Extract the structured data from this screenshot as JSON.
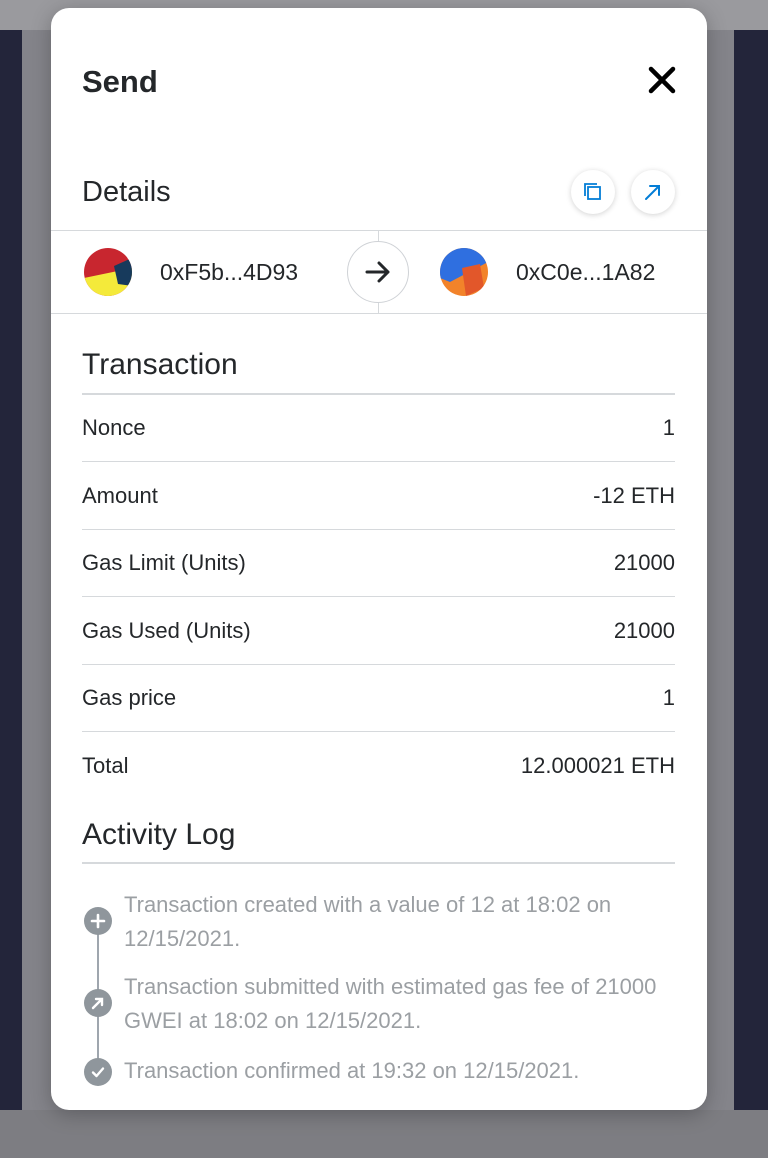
{
  "modal": {
    "title": "Send",
    "details_title": "Details",
    "from": {
      "address": "0xF5b...4D93"
    },
    "to": {
      "address": "0xC0e...1A82"
    }
  },
  "transaction": {
    "title": "Transaction",
    "rows": [
      {
        "label": "Nonce",
        "value": "1"
      },
      {
        "label": "Amount",
        "value": "-12 ETH"
      },
      {
        "label": "Gas Limit (Units)",
        "value": "21000"
      },
      {
        "label": "Gas Used (Units)",
        "value": "21000"
      },
      {
        "label": "Gas price",
        "value": "1"
      },
      {
        "label": "Total",
        "value": "12.000021 ETH"
      }
    ]
  },
  "activity": {
    "title": "Activity Log",
    "entries": [
      {
        "text": "Transaction created with a value of 12 at 18:02 on 12/15/2021.",
        "icon": "plus-icon"
      },
      {
        "text": "Transaction submitted with estimated gas fee of 21000 GWEI at 18:02 on 12/15/2021.",
        "icon": "arrow-up-right-icon"
      },
      {
        "text": "Transaction confirmed at 19:32 on 12/15/2021.",
        "icon": "check-icon"
      }
    ]
  },
  "colors": {
    "text": "#24272a",
    "muted_text": "#9b9fa3",
    "accent": "#037dd6",
    "divider": "#d6d9dc",
    "log_icon": "#8f969c"
  }
}
